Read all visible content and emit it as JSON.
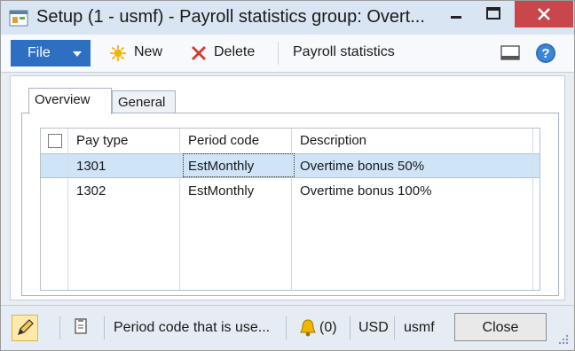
{
  "window": {
    "title": "Setup (1 - usmf) - Payroll statistics group: Overt...",
    "title_bar_color": "#d9e5f2",
    "close_color": "#c9464a"
  },
  "toolbar": {
    "file_label": "File",
    "new_label": "New",
    "delete_label": "Delete",
    "payroll_statistics_label": "Payroll statistics",
    "file_color": "#2e6fc2"
  },
  "tabs": [
    {
      "label": "Overview",
      "active": true
    },
    {
      "label": "General",
      "active": false
    }
  ],
  "grid": {
    "columns": [
      "Pay type",
      "Period code",
      "Description"
    ],
    "rows": [
      {
        "pay_type": "1301",
        "period_code": "EstMonthly",
        "description": "Overtime bonus 50%",
        "selected": true
      },
      {
        "pay_type": "1302",
        "period_code": "EstMonthly",
        "description": "Overtime bonus 100%",
        "selected": false
      }
    ],
    "selection_color": "#cfe4f7"
  },
  "statusbar": {
    "help_text": "Period code that is use...",
    "notifications": "(0)",
    "currency": "USD",
    "company": "usmf",
    "close_label": "Close"
  }
}
